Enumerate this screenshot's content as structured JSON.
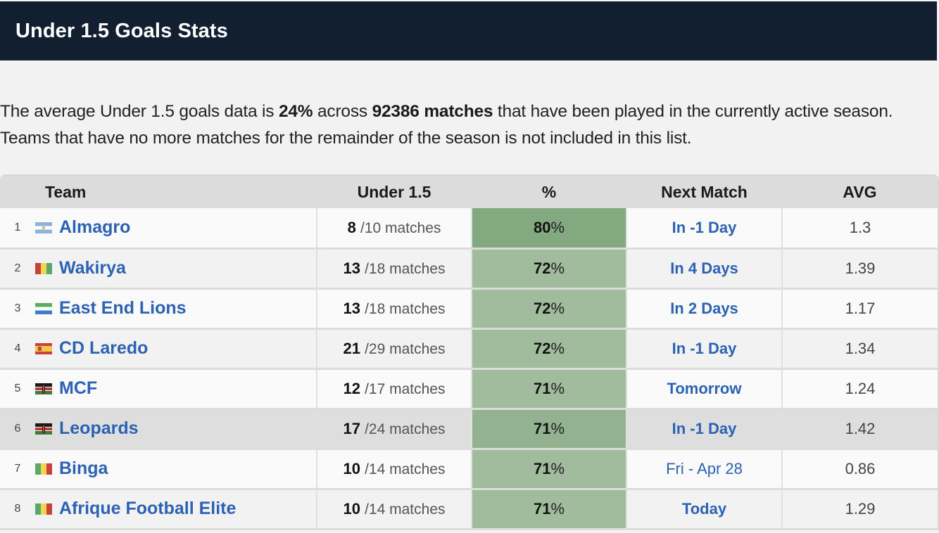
{
  "header": {
    "title": "Under 1.5 Goals Stats"
  },
  "description": {
    "part1": "The average Under 1.5 goals data is ",
    "avg_pct": "24%",
    "part2": " across ",
    "matches": "92386 matches",
    "part3": " that have been played in the currently active season. Teams that have no more matches for the remainder of the season is not included in this list."
  },
  "table": {
    "columns": [
      "Team",
      "Under 1.5",
      "%",
      "Next Match",
      "AVG"
    ],
    "rows": [
      {
        "rank": "1",
        "flag": "argentina-flag-icon",
        "team": "Almagro",
        "under": "8",
        "total": "/10 matches",
        "pct_num": "80",
        "pct_sign": "%",
        "next": "In -1 Day",
        "avg": "1.3"
      },
      {
        "rank": "2",
        "flag": "guinea-flag-icon",
        "team": "Wakirya",
        "under": "13",
        "total": "/18 matches",
        "pct_num": "72",
        "pct_sign": "%",
        "next": "In 4 Days",
        "avg": "1.39"
      },
      {
        "rank": "3",
        "flag": "sierra-leone-flag-icon",
        "team": "East End Lions",
        "under": "13",
        "total": "/18 matches",
        "pct_num": "72",
        "pct_sign": "%",
        "next": "In 2 Days",
        "avg": "1.17"
      },
      {
        "rank": "4",
        "flag": "spain-flag-icon",
        "team": "CD Laredo",
        "under": "21",
        "total": "/29 matches",
        "pct_num": "72",
        "pct_sign": "%",
        "next": "In -1 Day",
        "avg": "1.34"
      },
      {
        "rank": "5",
        "flag": "kenya-flag-icon",
        "team": "MCF",
        "under": "12",
        "total": "/17 matches",
        "pct_num": "71",
        "pct_sign": "%",
        "next": "Tomorrow",
        "avg": "1.24"
      },
      {
        "rank": "6",
        "flag": "kenya-flag-icon",
        "team": "Leopards",
        "under": "17",
        "total": "/24 matches",
        "pct_num": "71",
        "pct_sign": "%",
        "next": "In -1 Day",
        "avg": "1.42"
      },
      {
        "rank": "7",
        "flag": "mali-flag-icon",
        "team": "Binga",
        "under": "10",
        "total": "/14 matches",
        "pct_num": "71",
        "pct_sign": "%",
        "next": "Fri - Apr 28",
        "avg": "0.86"
      },
      {
        "rank": "8",
        "flag": "mali-flag-icon",
        "team": "Afrique Football Elite",
        "under": "10",
        "total": "/14 matches",
        "pct_num": "71",
        "pct_sign": "%",
        "next": "Today",
        "avg": "1.29"
      }
    ]
  },
  "colors": {
    "header_bg": "#121f30",
    "link": "#2b62b3",
    "pct_top": "#83a981",
    "pct_default": "#a0bc9d"
  }
}
